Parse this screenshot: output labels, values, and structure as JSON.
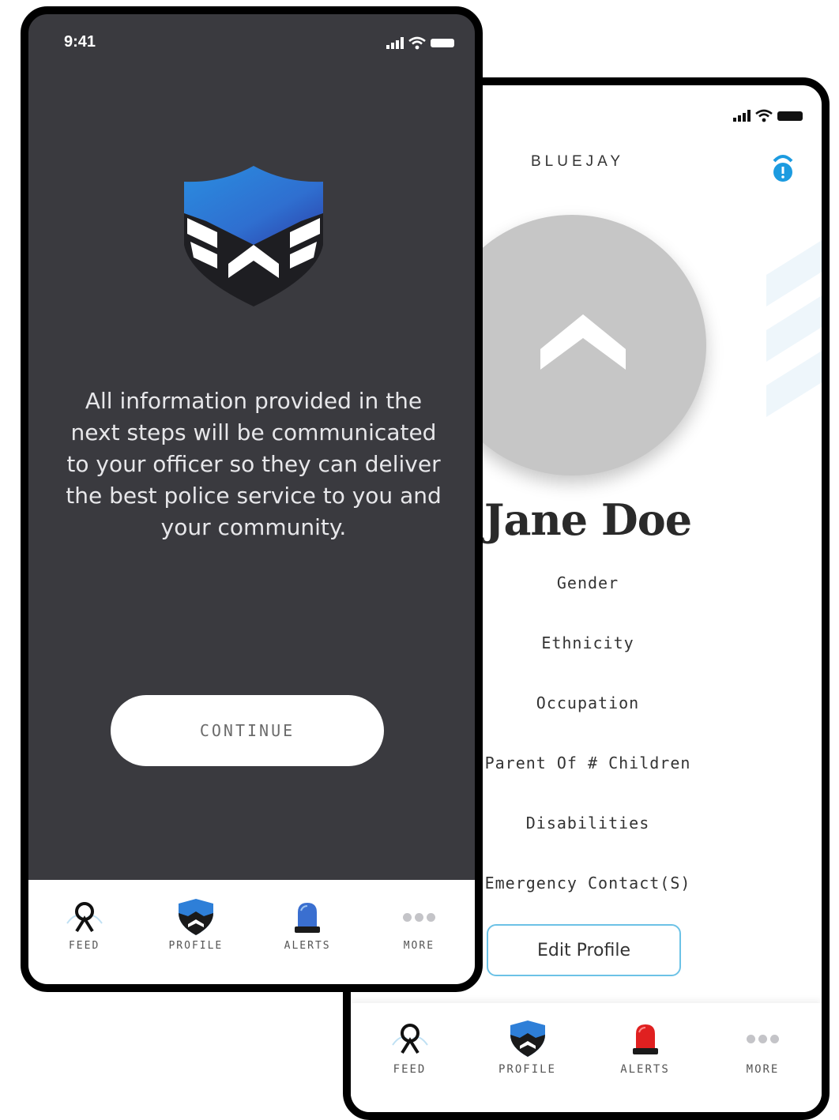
{
  "front_screen": {
    "status_time": "9:41",
    "message": "All information provided in the next steps will be communicated to your officer so they can deliver the best police service to you and your community.",
    "continue_label": "CONTINUE",
    "tabs": [
      {
        "label": "FEED",
        "icon": "feed-icon"
      },
      {
        "label": "PROFILE",
        "icon": "profile-shield-icon"
      },
      {
        "label": "ALERTS",
        "icon": "siren-icon"
      },
      {
        "label": "MORE",
        "icon": "more-dots-icon"
      }
    ]
  },
  "profile_screen": {
    "brand": "BLUEJAY",
    "name": "Jane Doe",
    "fields": [
      "Gender",
      "Ethnicity",
      "Occupation",
      "Parent Of # Children",
      "Disabilities",
      "Emergency Contact(S)"
    ],
    "edit_label": "Edit Profile",
    "tabs": [
      {
        "label": "FEED",
        "icon": "feed-icon"
      },
      {
        "label": "PROFILE",
        "icon": "profile-shield-icon"
      },
      {
        "label": "ALERTS",
        "icon": "siren-icon"
      },
      {
        "label": "MORE",
        "icon": "more-dots-icon"
      }
    ]
  },
  "colors": {
    "dark_background": "#3a3a3f",
    "brand_blue": "#1c9be0",
    "alert_red": "#e02020",
    "edit_border": "#6cc2e6",
    "avatar_gray": "#c6c6c6"
  }
}
